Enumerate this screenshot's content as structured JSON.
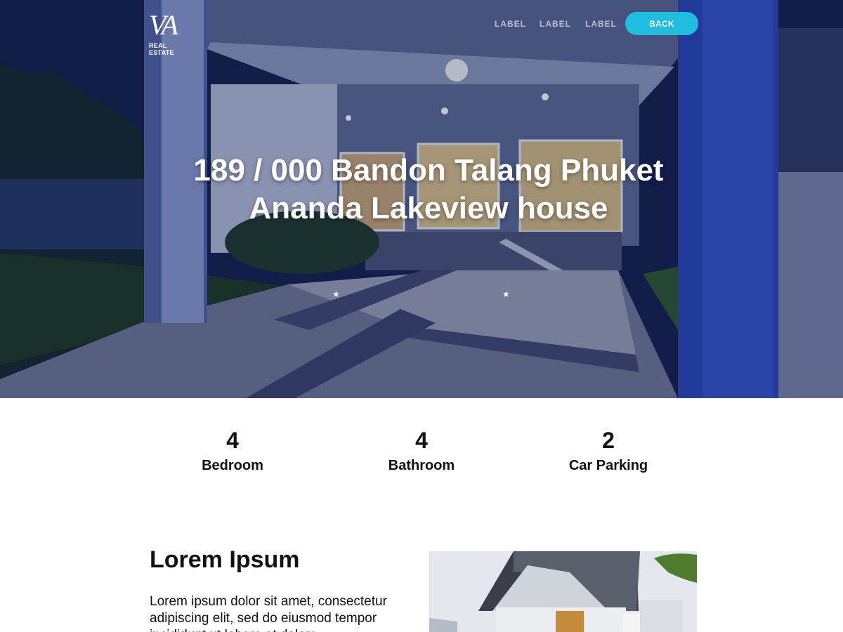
{
  "brand": {
    "logo_mark": "VA",
    "logo_text": "REAL ESTATE"
  },
  "nav": {
    "links": [
      "LABEL",
      "LABEL",
      "LABEL"
    ],
    "back_label": "BACK"
  },
  "hero": {
    "title_line1": "189 / 000 Bandon Talang Phuket",
    "title_line2": "Ananda Lakeview house"
  },
  "stats": [
    {
      "value": "4",
      "label": "Bedroom"
    },
    {
      "value": "4",
      "label": "Bathroom"
    },
    {
      "value": "2",
      "label": "Car Parking"
    }
  ],
  "content": {
    "title": "Lorem Ipsum",
    "body": "Lorem ipsum dolor sit amet, consectetur adipiscing elit, sed do eiusmod tempor incididunt ut labore et dolore"
  },
  "colors": {
    "accent": "#1fbde0",
    "hero_night": "#18285e",
    "text": "#111111"
  }
}
